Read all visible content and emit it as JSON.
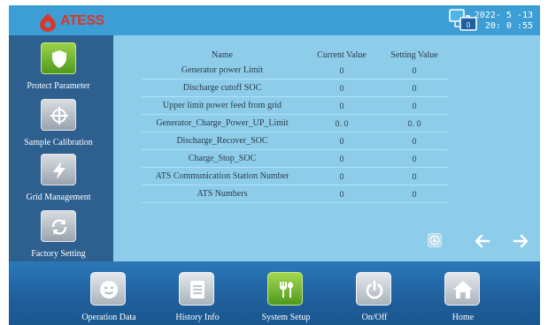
{
  "header": {
    "logo_text": "ATESS",
    "network_badge": "0",
    "date": "2022- 5 -13",
    "time": "20: 0 :55"
  },
  "sidebar": {
    "items": [
      {
        "label": "Protect Parameter",
        "icon": "shield-icon",
        "active": true
      },
      {
        "label": "Sample Calibration",
        "icon": "crosshair-icon",
        "active": false
      },
      {
        "label": "Grid Management",
        "icon": "lightning-icon",
        "active": false
      },
      {
        "label": "Factory Setting",
        "icon": "refresh-icon",
        "active": false
      }
    ]
  },
  "table": {
    "headers": {
      "name": "Name",
      "current": "Current Value",
      "setting": "Setting Value"
    },
    "rows": [
      {
        "name": "Generator power Limit",
        "current": "0",
        "setting": "0"
      },
      {
        "name": "Discharge cutoff SOC",
        "current": "0",
        "setting": "0"
      },
      {
        "name": "Upper limit power feed from grid",
        "current": "0",
        "setting": "0"
      },
      {
        "name": "Generator_Charge_Power_UP_Limit",
        "current": "0. 0",
        "setting": "0. 0"
      },
      {
        "name": "Discharge_Recover_SOC",
        "current": "0",
        "setting": "0"
      },
      {
        "name": "Charge_Stop_SOC",
        "current": "0",
        "setting": "0"
      },
      {
        "name": "ATS Communication Station Number",
        "current": "0",
        "setting": "0"
      },
      {
        "name": "ATS Numbers",
        "current": "0",
        "setting": "0"
      }
    ]
  },
  "bottom_nav": {
    "items": [
      {
        "label": "Operation Data",
        "icon": "smiley-icon",
        "active": false
      },
      {
        "label": "History Info",
        "icon": "document-icon",
        "active": false
      },
      {
        "label": "System Setup",
        "icon": "tools-icon",
        "active": true
      },
      {
        "label": "On/Off",
        "icon": "power-icon",
        "active": false
      },
      {
        "label": "Home",
        "icon": "home-icon",
        "active": false
      }
    ]
  },
  "colors": {
    "header_bg": "#3d9ed6",
    "sidebar_bg": "#2d5f8f",
    "content_bg": "#8ecdea",
    "active_green": "#6ab52e",
    "logo_red": "#d5392a"
  }
}
